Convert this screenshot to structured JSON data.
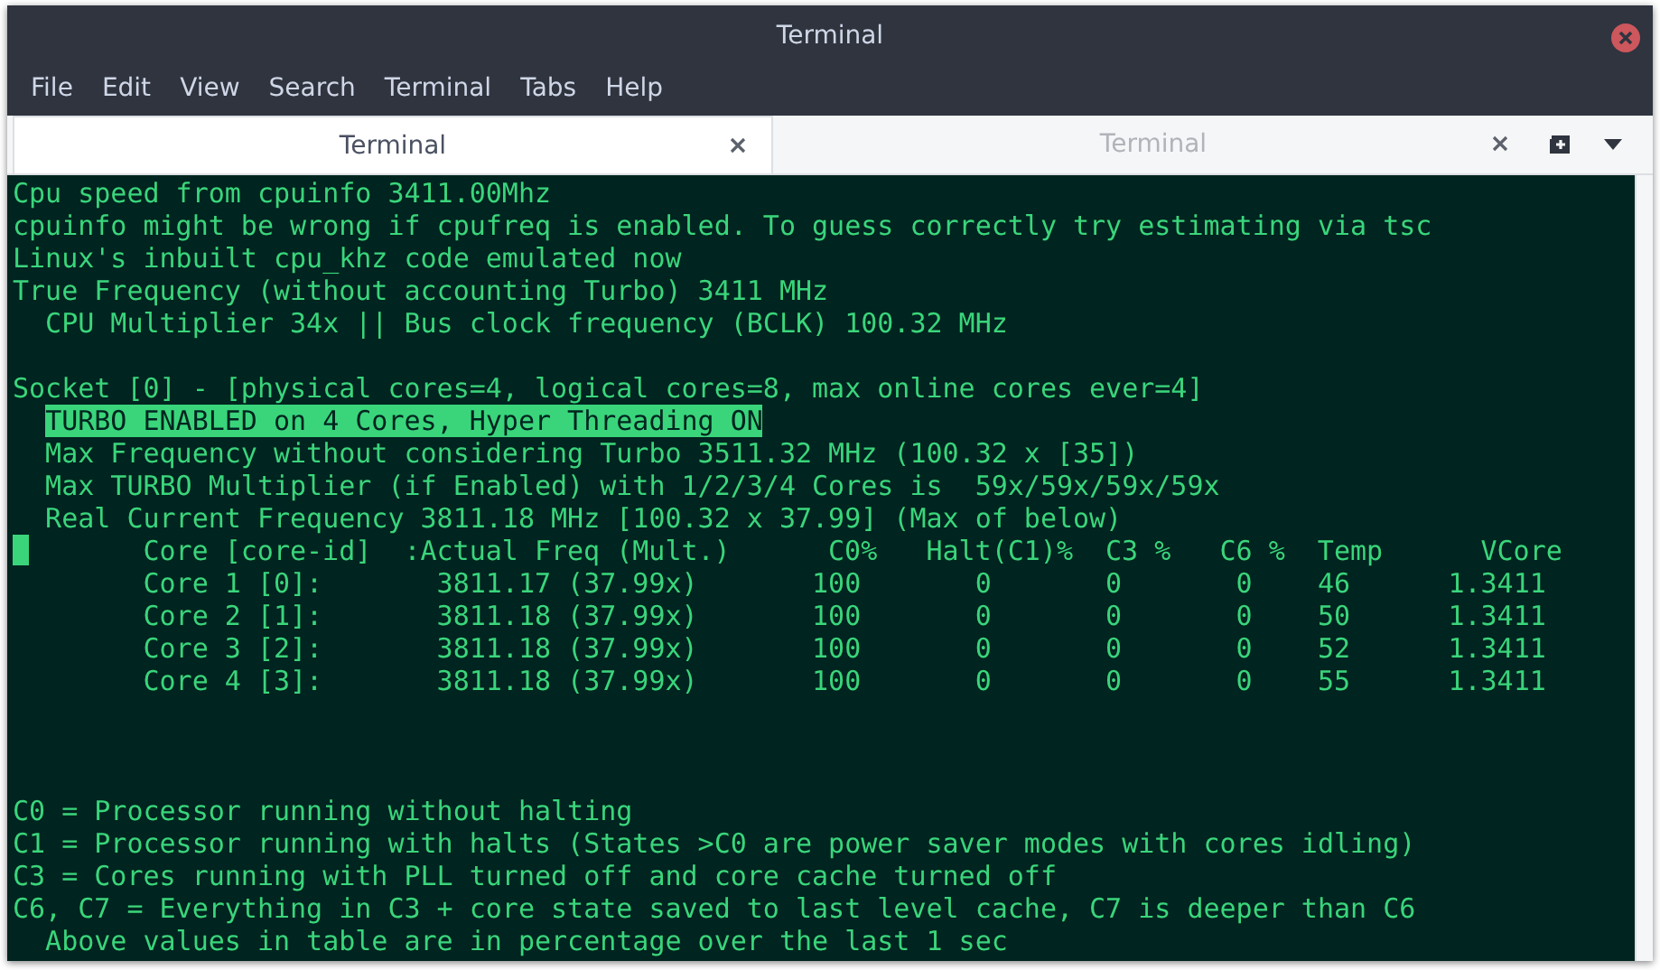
{
  "window": {
    "title": "Terminal"
  },
  "menu": [
    "File",
    "Edit",
    "View",
    "Search",
    "Terminal",
    "Tabs",
    "Help"
  ],
  "tabs": [
    {
      "label": "Terminal",
      "selected": true
    },
    {
      "label": "Terminal",
      "selected": false
    }
  ],
  "terminal": {
    "lines": [
      {
        "kind": "text",
        "text": "Cpu speed from cpuinfo 3411.00Mhz"
      },
      {
        "kind": "text",
        "text": "cpuinfo might be wrong if cpufreq is enabled. To guess correctly try estimating via tsc"
      },
      {
        "kind": "text",
        "text": "Linux's inbuilt cpu_khz code emulated now"
      },
      {
        "kind": "text",
        "text": "True Frequency (without accounting Turbo) 3411 MHz"
      },
      {
        "kind": "text",
        "text": "  CPU Multiplier 34x || Bus clock frequency (BCLK) 100.32 MHz"
      },
      {
        "kind": "blank"
      },
      {
        "kind": "text",
        "text": "Socket [0] - [physical cores=4, logical cores=8, max online cores ever=4]"
      },
      {
        "kind": "highlight",
        "text": "  TURBO ENABLED on 4 Cores, Hyper Threading ON"
      },
      {
        "kind": "text",
        "text": "  Max Frequency without considering Turbo 3511.32 MHz (100.32 x [35])"
      },
      {
        "kind": "text",
        "text": "  Max TURBO Multiplier (if Enabled) with 1/2/3/4 Cores is  59x/59x/59x/59x"
      },
      {
        "kind": "text",
        "text": "  Real Current Frequency 3811.18 MHz [100.32 x 37.99] (Max of below)"
      },
      {
        "kind": "cursor",
        "text": "       Core [core-id]  :Actual Freq (Mult.)      C0%   Halt(C1)%  C3 %   C6 %  Temp      VCore"
      },
      {
        "kind": "text",
        "text": "        Core 1 [0]:       3811.17 (37.99x)       100       0       0       0    46      1.3411"
      },
      {
        "kind": "text",
        "text": "        Core 2 [1]:       3811.18 (37.99x)       100       0       0       0    50      1.3411"
      },
      {
        "kind": "text",
        "text": "        Core 3 [2]:       3811.18 (37.99x)       100       0       0       0    52      1.3411"
      },
      {
        "kind": "text",
        "text": "        Core 4 [3]:       3811.18 (37.99x)       100       0       0       0    55      1.3411"
      },
      {
        "kind": "blank"
      },
      {
        "kind": "blank"
      },
      {
        "kind": "blank"
      },
      {
        "kind": "text",
        "text": "C0 = Processor running without halting"
      },
      {
        "kind": "text",
        "text": "C1 = Processor running with halts (States >C0 are power saver modes with cores idling)"
      },
      {
        "kind": "text",
        "text": "C3 = Cores running with PLL turned off and core cache turned off"
      },
      {
        "kind": "text",
        "text": "C6, C7 = Everything in C3 + core state saved to last level cache, C7 is deeper than C6"
      },
      {
        "kind": "text",
        "text": "  Above values in table are in percentage over the last 1 sec"
      }
    ]
  }
}
